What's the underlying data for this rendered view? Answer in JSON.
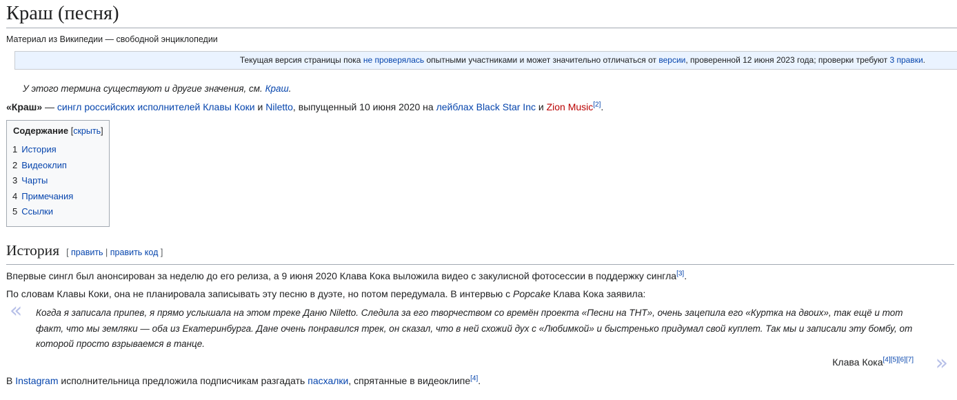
{
  "title": "Краш (песня)",
  "subtitle": "Материал из Википедии — свободной энциклопедии",
  "notice": {
    "t1": "Текущая версия страницы пока ",
    "l1": "не проверялась",
    "t2": " опытными участниками и может значительно отличаться от ",
    "l2": "версии",
    "t3": ", проверенной 12 июня 2023 года; проверки требуют ",
    "l3": "3 правки",
    "t4": "."
  },
  "hatnote": {
    "text": "У этого термина существуют и другие значения, см. ",
    "link": "Краш",
    "end": "."
  },
  "lead": {
    "bold": "«Краш»",
    "t1": " — ",
    "l1": "сингл",
    "t2": " ",
    "l2": "российских",
    "t3": " ",
    "l3": "исполнителей",
    "t4": " ",
    "l4": "Клавы Коки",
    "t5": " и ",
    "l5": "Niletto",
    "t6": ", выпущенный 10 июня 2020 на ",
    "l6": "лейблах",
    "t7": " ",
    "l7": "Black Star Inc",
    "t8": " и ",
    "l8": "Zion Music",
    "ref": "[2]",
    "t9": "."
  },
  "toc": {
    "title": "Содержание",
    "toggle_open": "[",
    "toggle": "скрыть",
    "toggle_close": "]",
    "items": [
      {
        "num": "1",
        "label": "История"
      },
      {
        "num": "2",
        "label": "Видеоклип"
      },
      {
        "num": "3",
        "label": "Чарты"
      },
      {
        "num": "4",
        "label": "Примечания"
      },
      {
        "num": "5",
        "label": "Ссылки"
      }
    ]
  },
  "section": {
    "title": "История",
    "edit_open": "[ ",
    "edit": "править",
    "sep": " | ",
    "edit_code": "править код",
    "edit_close": " ]"
  },
  "p1": {
    "text": "Впервые сингл был анонсирован за неделю до его релиза, а 9 июня 2020 Клава Кока выложила видео с закулисной фотосессии в поддержку сингла",
    "ref": "[3]",
    "end": "."
  },
  "p2": {
    "text": "По словам Клавы Коки, она не планировала записывать эту песню в дуэте, но потом передумала. В интервью с ",
    "italic": "Popcake",
    "end": " Клава Кока заявила:"
  },
  "quote": {
    "open": "«",
    "close": "»",
    "text": "Когда я записала припев, я прямо услышала на этом треке Даню Niletto. Следила за его творчеством со времён проекта «Песни на ТНТ», очень зацепила его «Куртка на двоих», так ещё и тот факт, что мы земляки — оба из Екатеринбурга. Дане очень понравился трек, он сказал, что в ней схожий дух с «Любимкой» и быстренько придумал свой куплет. Так мы и записали эту бомбу, от которой просто взрываемся в танце.",
    "author": "Клава Кока",
    "refs": [
      "[4]",
      "[5]",
      "[6]",
      "[7]"
    ]
  },
  "p3": {
    "t1": "В ",
    "l1": "Instagram",
    "t2": " исполнительница предложила подписчикам разгадать ",
    "l2": "пасхалки",
    "t3": ", спрятанные в видеоклипе",
    "ref": "[4]",
    "t4": "."
  }
}
